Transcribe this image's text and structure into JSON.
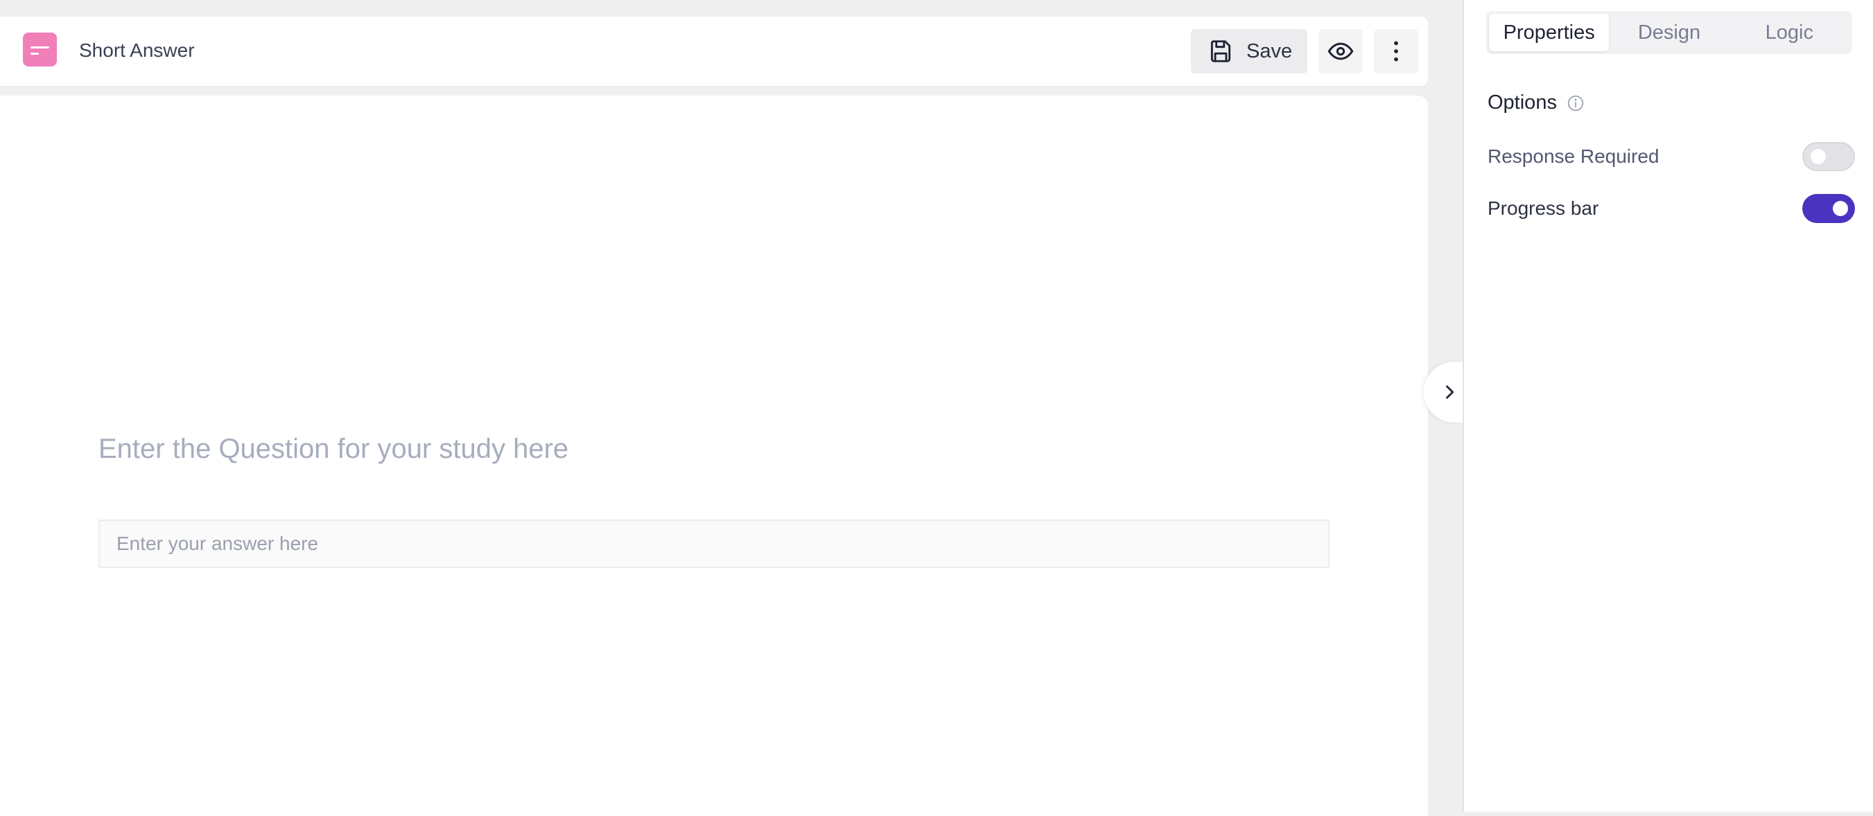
{
  "header": {
    "block_type_icon": "short-answer-icon",
    "block_title": "Short Answer",
    "save_label": "Save",
    "save_icon": "floppy-disk-icon",
    "preview_icon": "eye-icon",
    "more_icon": "vertical-dots-icon"
  },
  "canvas": {
    "question_placeholder": "Enter the Question for your study here",
    "answer_placeholder": "Enter your answer here",
    "answer_value": "",
    "collapse_icon": "chevron-right-icon"
  },
  "panel": {
    "tabs": [
      {
        "label": "Properties",
        "active": true
      },
      {
        "label": "Design",
        "active": false
      },
      {
        "label": "Logic",
        "active": false
      }
    ],
    "section_title": "Options",
    "section_icon": "info-icon",
    "options": [
      {
        "label": "Response Required",
        "enabled": false
      },
      {
        "label": "Progress bar",
        "enabled": true
      }
    ]
  },
  "colors": {
    "accent": "#4a33bf",
    "block_icon": "#f17fb8",
    "placeholder": "#a6adbd",
    "background": "#efeff0"
  }
}
